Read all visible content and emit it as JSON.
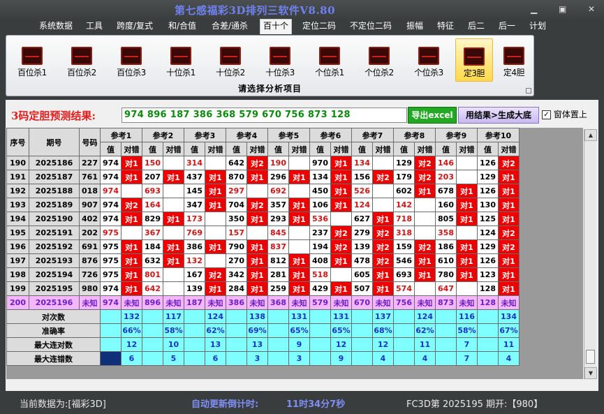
{
  "app": {
    "title": "第七感福彩3D排列三软件V8.80"
  },
  "menu": [
    "系统数据",
    "工具",
    "跨度/复式",
    "和/合值",
    "合差/通杀",
    "百十个",
    "定位二码",
    "不定位二码",
    "振幅",
    "特征",
    "后二",
    "后一",
    "计划"
  ],
  "ribbon": {
    "buttons": [
      "百位杀1",
      "百位杀2",
      "百位杀3",
      "十位杀1",
      "十位杀2",
      "十位杀3",
      "个位杀1",
      "个位杀2",
      "个位杀3",
      "定3胆",
      "定4胆"
    ],
    "footer": "请选择分析项目"
  },
  "prediction": {
    "label": "3码定胆预测结果:",
    "value": "974 896 187 386 368 579 670 756 873 128",
    "excel_button": "导出excel",
    "generate_button": "用结果>生成大底",
    "pin_label": "窗体置上",
    "pin_checked": "✓"
  },
  "table": {
    "headers": {
      "seq": "序号",
      "period": "期号",
      "number": "号码",
      "ref": [
        "参考1",
        "参考2",
        "参考3",
        "参考4",
        "参考5",
        "参考6",
        "参考7",
        "参考8",
        "参考9",
        "参考10"
      ],
      "val": "值",
      "hit": "对错"
    },
    "rows": [
      {
        "seq": "190",
        "period": "2025186",
        "num": "227",
        "cells": [
          [
            "974",
            "对1"
          ],
          [
            "150",
            ""
          ],
          [
            "314",
            ""
          ],
          [
            "642",
            "对2"
          ],
          [
            "190",
            ""
          ],
          [
            "970",
            "对1"
          ],
          [
            "134",
            ""
          ],
          [
            "129",
            "对2"
          ],
          [
            "146",
            ""
          ],
          [
            "126",
            "对2"
          ]
        ]
      },
      {
        "seq": "191",
        "period": "2025187",
        "num": "761",
        "cells": [
          [
            "974",
            "对1"
          ],
          [
            "207",
            "对1"
          ],
          [
            "437",
            "对1"
          ],
          [
            "870",
            "对1"
          ],
          [
            "296",
            "对1"
          ],
          [
            "134",
            "对1"
          ],
          [
            "156",
            "对2"
          ],
          [
            "179",
            "对2"
          ],
          [
            "203",
            ""
          ],
          [
            "129",
            "对1"
          ]
        ]
      },
      {
        "seq": "192",
        "period": "2025188",
        "num": "018",
        "cells": [
          [
            "974",
            ""
          ],
          [
            "693",
            ""
          ],
          [
            "145",
            "对1"
          ],
          [
            "297",
            ""
          ],
          [
            "692",
            ""
          ],
          [
            "450",
            "对1"
          ],
          [
            "526",
            ""
          ],
          [
            "602",
            "对1"
          ],
          [
            "678",
            "对1"
          ],
          [
            "126",
            "对1"
          ]
        ]
      },
      {
        "seq": "193",
        "period": "2025189",
        "num": "907",
        "cells": [
          [
            "974",
            "对2"
          ],
          [
            "164",
            ""
          ],
          [
            "347",
            "对1"
          ],
          [
            "704",
            "对2"
          ],
          [
            "357",
            "对1"
          ],
          [
            "106",
            "对1"
          ],
          [
            "124",
            ""
          ],
          [
            "142",
            ""
          ],
          [
            "160",
            "对1"
          ],
          [
            "130",
            "对1"
          ]
        ]
      },
      {
        "seq": "194",
        "period": "2025190",
        "num": "402",
        "cells": [
          [
            "974",
            "对1"
          ],
          [
            "829",
            "对1"
          ],
          [
            "173",
            ""
          ],
          [
            "350",
            "对1"
          ],
          [
            "293",
            "对1"
          ],
          [
            "536",
            ""
          ],
          [
            "627",
            "对1"
          ],
          [
            "718",
            ""
          ],
          [
            "805",
            "对1"
          ],
          [
            "125",
            "对1"
          ]
        ]
      },
      {
        "seq": "195",
        "period": "2025191",
        "num": "202",
        "cells": [
          [
            "975",
            ""
          ],
          [
            "367",
            ""
          ],
          [
            "769",
            ""
          ],
          [
            "157",
            ""
          ],
          [
            "845",
            ""
          ],
          [
            "237",
            "对2"
          ],
          [
            "279",
            "对2"
          ],
          [
            "318",
            ""
          ],
          [
            "358",
            ""
          ],
          [
            "124",
            "对2"
          ]
        ]
      },
      {
        "seq": "196",
        "period": "2025192",
        "num": "691",
        "cells": [
          [
            "975",
            "对1"
          ],
          [
            "184",
            "对1"
          ],
          [
            "386",
            "对1"
          ],
          [
            "790",
            "对1"
          ],
          [
            "837",
            ""
          ],
          [
            "194",
            "对2"
          ],
          [
            "139",
            "对2"
          ],
          [
            "159",
            "对2"
          ],
          [
            "186",
            "对1"
          ],
          [
            "129",
            "对2"
          ]
        ]
      },
      {
        "seq": "197",
        "period": "2025193",
        "num": "876",
        "cells": [
          [
            "975",
            "对1"
          ],
          [
            "632",
            "对1"
          ],
          [
            "132",
            ""
          ],
          [
            "270",
            "对1"
          ],
          [
            "812",
            "对1"
          ],
          [
            "408",
            "对1"
          ],
          [
            "478",
            "对2"
          ],
          [
            "546",
            "对1"
          ],
          [
            "610",
            "对1"
          ],
          [
            "126",
            "对1"
          ]
        ]
      },
      {
        "seq": "198",
        "period": "2025194",
        "num": "726",
        "cells": [
          [
            "975",
            "对1"
          ],
          [
            "801",
            ""
          ],
          [
            "167",
            "对2"
          ],
          [
            "342",
            "对1"
          ],
          [
            "281",
            "对1"
          ],
          [
            "518",
            ""
          ],
          [
            "605",
            "对1"
          ],
          [
            "693",
            "对1"
          ],
          [
            "780",
            "对1"
          ],
          [
            "123",
            "对1"
          ]
        ]
      },
      {
        "seq": "199",
        "period": "2025195",
        "num": "980",
        "cells": [
          [
            "974",
            "对1"
          ],
          [
            "642",
            ""
          ],
          [
            "139",
            "对1"
          ],
          [
            "284",
            "对1"
          ],
          [
            "259",
            "对1"
          ],
          [
            "429",
            "对1"
          ],
          [
            "507",
            "对1"
          ],
          [
            "574",
            ""
          ],
          [
            "647",
            ""
          ],
          [
            "128",
            "对1"
          ]
        ]
      }
    ],
    "predict_row": {
      "seq": "200",
      "period": "2025196",
      "num": "未知",
      "cells": [
        [
          "974",
          "未知"
        ],
        [
          "896",
          "未知"
        ],
        [
          "187",
          "未知"
        ],
        [
          "386",
          "未知"
        ],
        [
          "368",
          "未知"
        ],
        [
          "579",
          "未知"
        ],
        [
          "670",
          "未知"
        ],
        [
          "756",
          "未知"
        ],
        [
          "873",
          "未知"
        ],
        [
          "128",
          "未知"
        ]
      ]
    },
    "stats": [
      {
        "label": "对次数",
        "values": [
          "132",
          "117",
          "124",
          "138",
          "131",
          "131",
          "137",
          "124",
          "116",
          "134"
        ]
      },
      {
        "label": "准确率",
        "values": [
          "66%",
          "58%",
          "62%",
          "69%",
          "65%",
          "65%",
          "68%",
          "62%",
          "58%",
          "67%"
        ]
      },
      {
        "label": "最大连对数",
        "values": [
          "12",
          "10",
          "13",
          "13",
          "9",
          "12",
          "12",
          "11",
          "7",
          "11"
        ]
      },
      {
        "label": "最大连错数",
        "values": [
          "6",
          "5",
          "6",
          "3",
          "3",
          "9",
          "4",
          "4",
          "7",
          "4"
        ]
      }
    ]
  },
  "status": {
    "current": "当前数据为:[福彩3D]",
    "countdown_label": "自动更新倒计时:",
    "countdown": "11时34分7秒",
    "latest": "FC3D第 2025195 期开:【980】"
  },
  "colors": {
    "hit": "#ee0000",
    "predict_row": "#f4b6ff",
    "stats_row": "#7fffff",
    "prediction_text": "#0a8a0a",
    "title": "#6f82f0"
  }
}
